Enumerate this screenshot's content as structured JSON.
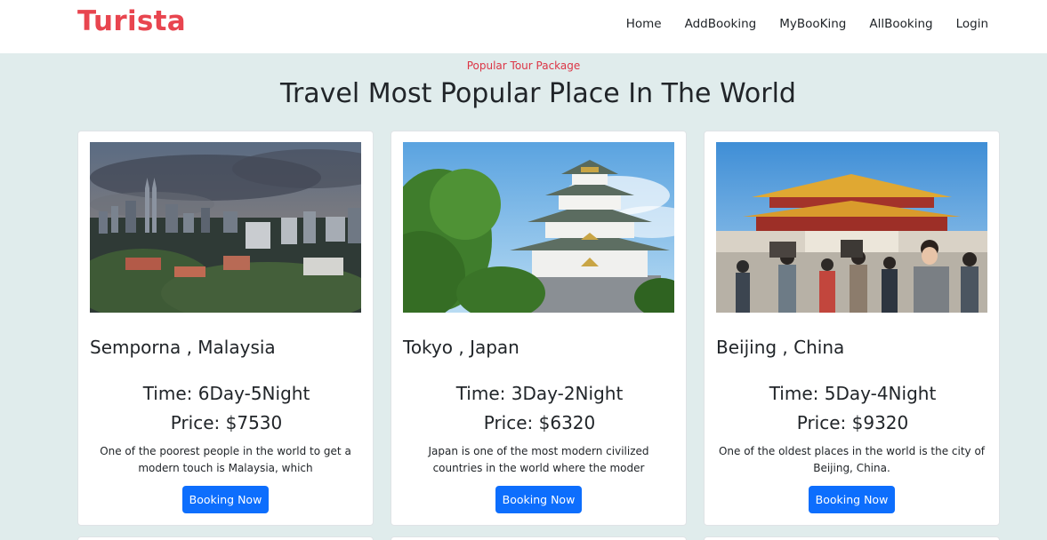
{
  "navbar": {
    "brand": "Turista",
    "links": [
      "Home",
      "AddBooking",
      "MyBooKing",
      "AllBooking",
      "Login"
    ]
  },
  "section": {
    "subtitle": "Popular Tour Package",
    "heading": "Travel Most Popular Place In The World"
  },
  "cards": [
    {
      "title": "Semporna , Malaysia",
      "time": "Time: 6Day-5Night",
      "price": "Price: $7530",
      "description": "One of the poorest people in the world to get a modern touch is Malaysia, which",
      "button": "Booking Now"
    },
    {
      "title": "Tokyo , Japan",
      "time": "Time: 3Day-2Night",
      "price": "Price: $6320",
      "description": "Japan is one of the most modern civilized countries in the world where the moder",
      "button": "Booking Now"
    },
    {
      "title": "Beijing , China",
      "time": "Time: 5Day-4Night",
      "price": "Price: $9320",
      "description": "One of the oldest places in the world is the city of Beijing, China.",
      "button": "Booking Now"
    }
  ],
  "colors": {
    "brand": "#e8454f",
    "accent": "#0d6efd",
    "subtitle": "#dc3545",
    "background": "#e0ecec"
  }
}
